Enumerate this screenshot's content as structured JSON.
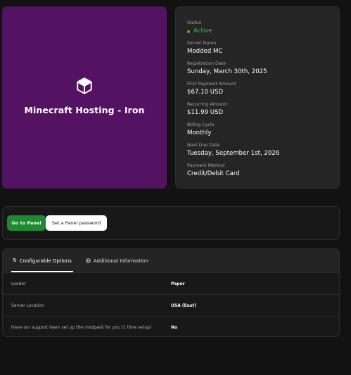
{
  "product": {
    "title": "Minecraft Hosting - Iron",
    "icon": "cube-icon",
    "color": "#541262"
  },
  "details": {
    "status": {
      "label": "Status",
      "value": "Active",
      "color": "#35c24a"
    },
    "server_name": {
      "label": "Server Name",
      "value": "Modded MC"
    },
    "registration_date": {
      "label": "Registration Date",
      "value": "Sunday, March 30th, 2025"
    },
    "first_payment": {
      "label": "First Payment Amount",
      "value": "$67.10 USD"
    },
    "recurring_amount": {
      "label": "Recurring Amount",
      "value": "$11.99 USD"
    },
    "billing_cycle": {
      "label": "Billing Cycle",
      "value": "Monthly"
    },
    "next_due_date": {
      "label": "Next Due Date",
      "value": "Tuesday, September 1st, 2026"
    },
    "payment_method": {
      "label": "Payment Method",
      "value": "Credit/Debit Card"
    }
  },
  "actions": {
    "go_to_panel": "Go to Panel",
    "set_panel_password": "Set a Panel password",
    "primary_color": "#1e8a32"
  },
  "tabs": {
    "configurable_options": "Configurable Options",
    "additional_information": "Additional Information"
  },
  "options": [
    {
      "label": "Loader",
      "value": "Paper"
    },
    {
      "label": "Server Location",
      "value": "USA (East)"
    },
    {
      "label": "Have our support team set up the modpack for you (1 time setup)",
      "value": "No"
    }
  ]
}
